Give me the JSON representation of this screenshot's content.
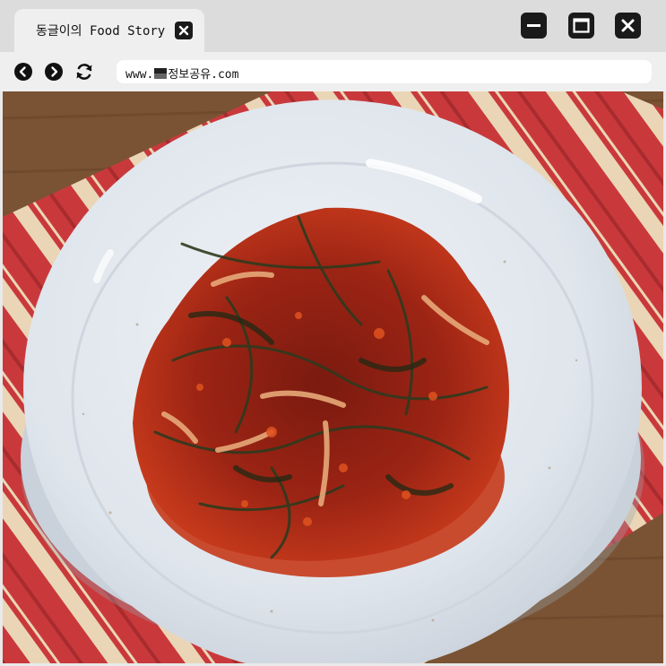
{
  "browser": {
    "tab": {
      "title": "동글이의 Food Story",
      "close_icon": "close-icon"
    },
    "window_controls": {
      "minimize_icon": "minimize-icon",
      "maximize_icon": "maximize-icon",
      "close_icon": "close-icon"
    },
    "nav": {
      "back_icon": "chevron-left-icon",
      "forward_icon": "chevron-right-icon",
      "reload_icon": "reload-icon"
    },
    "address": {
      "prefix": "www.",
      "domain": "정보공유",
      "suffix": ".com"
    }
  },
  "content": {
    "photo": "overhead photo of a white speckled plate holding red-seasoned leafy greens kimchi on a red and cream striped cloth over a wooden table"
  },
  "colors": {
    "chrome_dark": "#1a1a1a",
    "tabstrip": "#dcdcdc",
    "toolbar": "#efefef",
    "plate": "#dfe5ec",
    "cloth_red": "#c8373a",
    "cloth_cream": "#ead6b6",
    "table_wood": "#7a5334"
  }
}
